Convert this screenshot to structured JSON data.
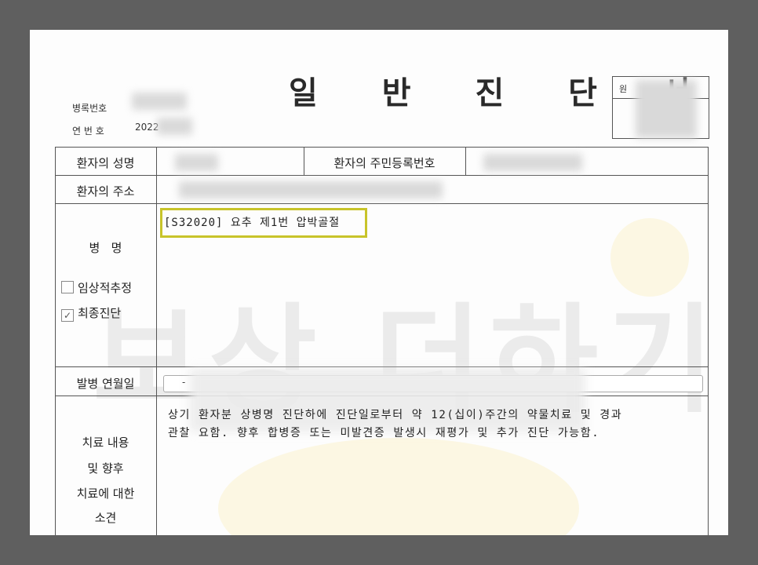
{
  "document": {
    "title": "일 반 진 단 서",
    "record_label": "병록번호",
    "serial_label": "연 번 호",
    "serial_value": "2022",
    "stamp_label": "원"
  },
  "table": {
    "name_label": "환자의 성명",
    "rrn_label": "환자의 주민등록번호",
    "address_label": "환자의 주소",
    "disease_label": "병   명",
    "diagnosis_text": "[S32020] 요추 제1번 압박골절",
    "option_provisional": "임상적추정",
    "option_final": "최종진단",
    "option_final_checked": true,
    "onset_label": "발병 연월일",
    "onset_value": "-",
    "opinion_label_1": "치료 내용",
    "opinion_label_2": "및 향후",
    "opinion_label_3": "치료에 대한",
    "opinion_label_4": "소견",
    "opinion_line_1": "상기 환자분 상병명 진단하에 진단일로부터 약 12(십이)주간의 약물치료 및 경과",
    "opinion_line_2": "관찰 요함. 향후 합병증 또는 미발견증 발생시 재평가 및 추가 진단 가능함."
  },
  "colors": {
    "highlight": "#c8c42a",
    "background": "#5f5f5f",
    "paper": "#fdfdfd"
  },
  "watermark": "보상 더하기"
}
